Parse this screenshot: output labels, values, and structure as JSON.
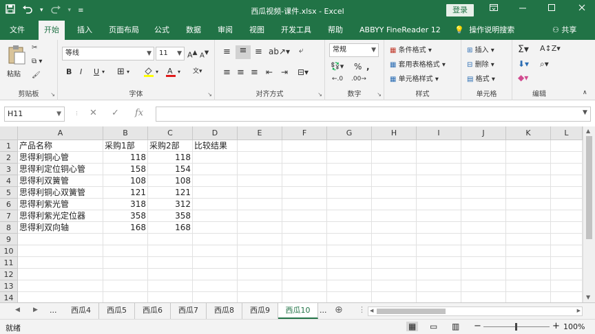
{
  "titlebar": {
    "title": "西瓜视频-课件.xlsx  -  Excel",
    "login_label": "登录",
    "qat_icons": [
      "save-icon",
      "undo-icon",
      "redo-icon",
      "customize-icon"
    ],
    "controls": [
      "ribbon-display-icon",
      "minimize-icon",
      "maximize-icon",
      "close-icon"
    ]
  },
  "tabs": [
    "文件",
    "开始",
    "插入",
    "页面布局",
    "公式",
    "数据",
    "审阅",
    "视图",
    "开发工具",
    "帮助",
    "ABBYY FineReader 12"
  ],
  "active_tab": "开始",
  "tellme": "操作说明搜索",
  "share": "共享",
  "ribbon": {
    "clipboard": {
      "label": "剪贴板",
      "paste": "粘贴"
    },
    "font": {
      "label": "字体",
      "name": "等线",
      "size": "11",
      "bold": "B",
      "italic": "I",
      "underline": "U"
    },
    "alignment": {
      "label": "对齐方式"
    },
    "number": {
      "label": "数字",
      "format": "常规",
      "percent": "%"
    },
    "styles": {
      "label": "样式",
      "conditional": "条件格式",
      "table": "套用表格格式",
      "cell": "单元格样式"
    },
    "cells": {
      "label": "单元格",
      "insert": "插入",
      "delete": "删除",
      "format": "格式"
    },
    "editing": {
      "label": "编辑"
    }
  },
  "formula_bar": {
    "namebox": "H11",
    "cancel": "✕",
    "enter": "✓",
    "fx": "fx",
    "value": ""
  },
  "grid": {
    "columns": [
      "A",
      "B",
      "C",
      "D",
      "E",
      "F",
      "G",
      "H",
      "I",
      "J",
      "K",
      "L"
    ],
    "row_numbers": [
      "1",
      "2",
      "3",
      "4",
      "5",
      "6",
      "7",
      "8",
      "9",
      "10",
      "11",
      "12",
      "13",
      "14"
    ],
    "headers": [
      "产品名称",
      "采购1部",
      "采购2部",
      "比较结果"
    ],
    "rows": [
      [
        "思得利铜心管",
        "118",
        "118"
      ],
      [
        "思得利定位铜心管",
        "158",
        "154"
      ],
      [
        "思得利双簧管",
        "108",
        "108"
      ],
      [
        "思得利铜心双簧管",
        "121",
        "121"
      ],
      [
        "思得利紫光管",
        "318",
        "312"
      ],
      [
        "思得利紫光定位器",
        "358",
        "358"
      ],
      [
        "思得利双向轴",
        "168",
        "168"
      ]
    ]
  },
  "sheets": {
    "nav_more_left": "...",
    "tabs": [
      "西瓜4",
      "西瓜5",
      "西瓜6",
      "西瓜7",
      "西瓜8",
      "西瓜9",
      "西瓜10"
    ],
    "active": "西瓜10",
    "nav_more_right": "...",
    "add": "⊕"
  },
  "status": {
    "ready": "就绪",
    "zoom": "100%",
    "zoom_minus": "−",
    "zoom_plus": "+"
  }
}
